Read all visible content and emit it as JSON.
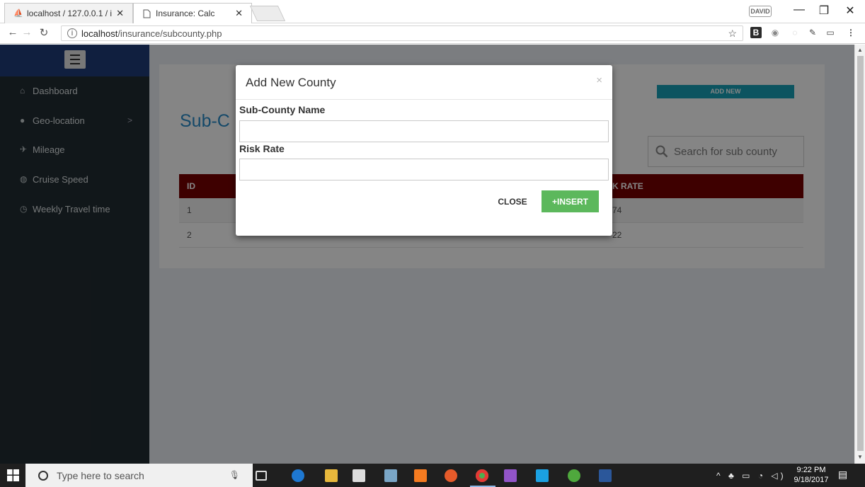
{
  "browser": {
    "tabs": [
      {
        "title": "localhost / 127.0.0.1 / ins",
        "favicon": "phpmyadmin-icon"
      },
      {
        "title": "Insurance: Calc",
        "favicon": "page-icon"
      }
    ],
    "profile": "DAVID",
    "url_host": "localhost",
    "url_path": "/insurance/subcounty.php"
  },
  "sidebar": {
    "items": [
      {
        "label": "Dashboard",
        "icon": "home-icon"
      },
      {
        "label": "Geo-location",
        "icon": "map-marker-icon",
        "chevron": ">"
      },
      {
        "label": "Mileage",
        "icon": "plane-icon"
      },
      {
        "label": "Cruise Speed",
        "icon": "tachometer-icon"
      },
      {
        "label": "Weekly Travel time",
        "icon": "clock-icon"
      }
    ]
  },
  "main": {
    "add_new": "ADD NEW",
    "title": "Sub-C",
    "search_placeholder": "Search for  sub county",
    "table": {
      "headers": {
        "id": "ID",
        "rate": "K RATE"
      },
      "rows": [
        {
          "id": "1",
          "name": "",
          "rate": "74"
        },
        {
          "id": "2",
          "name": "",
          "rate": "22"
        }
      ]
    }
  },
  "modal": {
    "title": "Add New County",
    "close_glyph": "×",
    "name_label": "Sub-County Name",
    "rate_label": "Risk Rate",
    "name_value": "",
    "rate_value": "",
    "close_button": "CLOSE",
    "insert_button": "+INSERT"
  },
  "taskbar": {
    "search_placeholder": "Type here to search",
    "time": "9:22 PM",
    "date": "9/18/2017"
  },
  "colors": {
    "sidebar_bg": "#222d32",
    "sidebar_header": "#1f3d7a",
    "table_header": "#780000",
    "accent_title": "#2a8cc9",
    "add_new": "#17a2b8",
    "insert": "#5cb85c"
  }
}
